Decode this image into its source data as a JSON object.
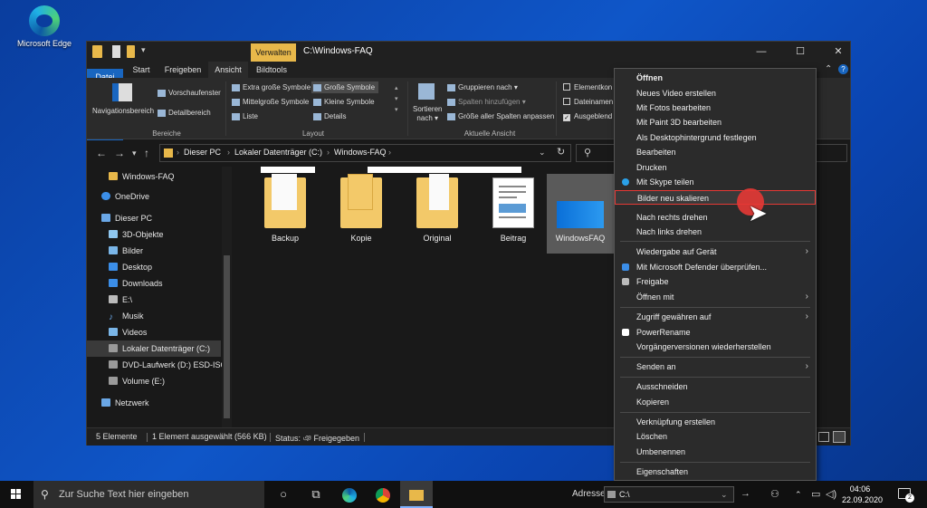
{
  "desktop": {
    "edge_label": "Microsoft Edge"
  },
  "window": {
    "manage_tab": "Verwalten",
    "path_title": "C:\\Windows-FAQ",
    "controls": {
      "minimize": "—",
      "maximize": "☐",
      "close": "✕"
    }
  },
  "ribbon_tabs": [
    "Datei",
    "Start",
    "Freigeben",
    "Ansicht",
    "Bildtools"
  ],
  "ribbon": {
    "panes": {
      "nav_pane": "Navigationsbereich",
      "preview": "Vorschaufenster",
      "details": "Detailbereich",
      "group": "Bereiche"
    },
    "layout": {
      "items": [
        "Extra große Symbole",
        "Große Symbole",
        "Mittelgroße Symbole",
        "Kleine Symbole",
        "Liste",
        "Details"
      ],
      "group": "Layout"
    },
    "current_view": {
      "sort_label": "Sortieren",
      "sort_sub": "nach",
      "group_by": "Gruppieren nach",
      "add_columns": "Spalten hinzufügen",
      "size_columns": "Größe aller Spalten anpassen",
      "group": "Aktuelle Ansicht"
    },
    "show_hide": {
      "item_checkboxes": "Elementkon",
      "extensions": "Dateinamen",
      "hidden": "Ausgeblend"
    }
  },
  "address": {
    "crumbs": [
      "Dieser PC",
      "Lokaler Datenträger (C:)",
      "Windows-FAQ"
    ]
  },
  "nav": {
    "items": [
      {
        "label": "Windows-FAQ",
        "color": "#e8b84a"
      },
      {
        "label": "OneDrive",
        "color": "#3b8ee8"
      },
      {
        "label": "Dieser PC",
        "color": "#6aa7e6"
      },
      {
        "label": "3D-Objekte",
        "color": "#8fc7f0"
      },
      {
        "label": "Bilder",
        "color": "#7ab6e8"
      },
      {
        "label": "Desktop",
        "color": "#3b8ee8"
      },
      {
        "label": "Downloads",
        "color": "#3b8ee8"
      },
      {
        "label": "E:\\",
        "color": "#bbbbbb"
      },
      {
        "label": "Musik",
        "color": "#6aa7e6"
      },
      {
        "label": "Videos",
        "color": "#7ab6e8"
      },
      {
        "label": "Lokaler Datenträger (C:)",
        "color": "#9a9a9a"
      },
      {
        "label": "DVD-Laufwerk (D:) ESD-ISO",
        "color": "#9a9a9a"
      },
      {
        "label": "Volume (E:)",
        "color": "#9a9a9a"
      },
      {
        "label": "Netzwerk",
        "color": "#6aa7e6"
      }
    ]
  },
  "files": [
    {
      "label": "Backup",
      "kind": "folder"
    },
    {
      "label": "Kopie",
      "kind": "folder"
    },
    {
      "label": "Original",
      "kind": "folder"
    },
    {
      "label": "Beitrag",
      "kind": "doc"
    },
    {
      "label": "WindowsFAQ",
      "kind": "image"
    }
  ],
  "status": {
    "count": "5 Elemente",
    "selected": "1 Element ausgewählt (566 KB)",
    "state": "Status: ঞ Freigegeben"
  },
  "context_menu": {
    "items": [
      {
        "label": "Öffnen",
        "bold": true
      },
      {
        "label": "Neues Video erstellen"
      },
      {
        "label": "Mit Fotos bearbeiten"
      },
      {
        "label": "Mit Paint 3D bearbeiten"
      },
      {
        "label": "Als Desktophintergrund festlegen"
      },
      {
        "label": "Bearbeiten"
      },
      {
        "label": "Drucken"
      },
      {
        "label": "Mit Skype teilen",
        "icon": "#2aa0e8"
      },
      {
        "label": "Bilder neu skalieren",
        "highlight": true
      },
      {
        "label": "Nach rechts drehen"
      },
      {
        "label": "Nach links drehen"
      },
      {
        "label": "Wiedergabe auf Gerät",
        "submenu": true
      },
      {
        "label": "Mit Microsoft Defender überprüfen...",
        "icon": "#3b8ee8"
      },
      {
        "label": "Freigabe",
        "icon": "#bbbbbb"
      },
      {
        "label": "Öffnen mit",
        "submenu": true
      },
      {
        "label": "Zugriff gewähren auf",
        "submenu": true
      },
      {
        "label": "PowerRename",
        "icon": "#ffffff"
      },
      {
        "label": "Vorgängerversionen wiederherstellen"
      },
      {
        "label": "Senden an",
        "submenu": true
      },
      {
        "label": "Ausschneiden"
      },
      {
        "label": "Kopieren"
      },
      {
        "label": "Verknüpfung erstellen"
      },
      {
        "label": "Löschen"
      },
      {
        "label": "Umbenennen"
      },
      {
        "label": "Eigenschaften"
      }
    ]
  },
  "taskbar": {
    "search_placeholder": "Zur Suche Text hier eingeben",
    "address_label": "Adresse",
    "address_value": "C:\\",
    "time": "04:06",
    "date": "22.09.2020",
    "notif_count": "2"
  }
}
